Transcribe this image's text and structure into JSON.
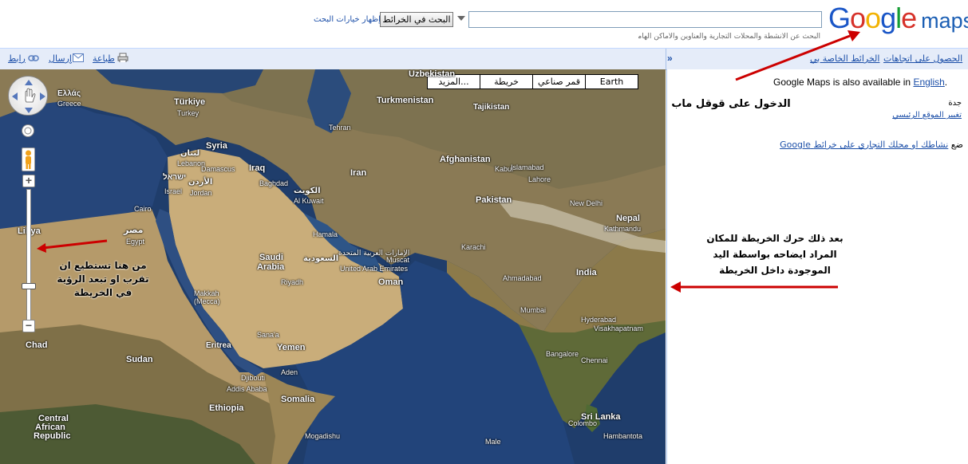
{
  "header": {
    "logo_google": "Google",
    "logo_maps": "maps",
    "search_value": "",
    "search_button": "البحث في الخرائط",
    "show_options": "إظهار خيارات البحث",
    "search_hint": "البحث عن الأنشطة والمحلات التجارية والعناوين والأماكن الهامة."
  },
  "toolbar": {
    "get_directions": "الحصول على اتجاهات",
    "my_maps": "الخرائط الخاصة بي",
    "print": "طباعة",
    "send": "إرسال",
    "link": "رابط",
    "collapse": "»"
  },
  "map_types": [
    "Earth",
    "قمر صناعي",
    "خريطة",
    "المزيد..."
  ],
  "map_labels": [
    {
      "name": "Uzbekistan"
    },
    {
      "name": "Turkmenistan"
    },
    {
      "name": "Tajikistan"
    },
    {
      "name": "Türkiye"
    },
    {
      "name": "Turkey"
    },
    {
      "name": "Ελλάς"
    },
    {
      "name": "Greece"
    },
    {
      "name": "Syria"
    },
    {
      "name": "لبنان"
    },
    {
      "name": "Lebanon"
    },
    {
      "name": "ישראל"
    },
    {
      "name": "Israel"
    },
    {
      "name": "الأردن"
    },
    {
      "name": "Jordan"
    },
    {
      "name": "Iraq"
    },
    {
      "name": "Iran"
    },
    {
      "name": "Afghanistan"
    },
    {
      "name": "Pakistan"
    },
    {
      "name": "Nepal"
    },
    {
      "name": "India"
    },
    {
      "name": "الكويت"
    },
    {
      "name": "Al Kuwait"
    },
    {
      "name": "مصر"
    },
    {
      "name": "Egypt"
    },
    {
      "name": "Libya"
    },
    {
      "name": "Saudi"
    },
    {
      "name": "Arabia"
    },
    {
      "name": "السعودية"
    },
    {
      "name": "الإمارات العربية المتحدة"
    },
    {
      "name": "United Arab Emirates"
    },
    {
      "name": "Oman"
    },
    {
      "name": "Muscat"
    },
    {
      "name": "Karachi"
    },
    {
      "name": "Ahmadabad"
    },
    {
      "name": "Mumbai"
    },
    {
      "name": "Hyderabad"
    },
    {
      "name": "Visakhapatnam"
    },
    {
      "name": "Bangalore"
    },
    {
      "name": "Chennai"
    },
    {
      "name": "Sri Lanka"
    },
    {
      "name": "Yemen"
    },
    {
      "name": "Eritrea"
    },
    {
      "name": "Sudan"
    },
    {
      "name": "Djibouti"
    },
    {
      "name": "Somalia"
    },
    {
      "name": "Ethiopia"
    },
    {
      "name": "Chad"
    },
    {
      "name": "Central"
    },
    {
      "name": "African"
    },
    {
      "name": "Republic"
    },
    {
      "name": "Riyadh"
    },
    {
      "name": "Makkah"
    },
    {
      "name": "(Mecca)"
    },
    {
      "name": "Tehran"
    },
    {
      "name": "Kabul"
    },
    {
      "name": "Islamabad"
    },
    {
      "name": "Lahore"
    },
    {
      "name": "New Delhi"
    },
    {
      "name": "Kathmandu"
    },
    {
      "name": "Baghdad"
    },
    {
      "name": "Damascus"
    },
    {
      "name": "Cairo"
    },
    {
      "name": "Hamala"
    },
    {
      "name": "Sana'a"
    },
    {
      "name": "Aden"
    },
    {
      "name": "Addis Ababa"
    },
    {
      "name": "Mogadishu"
    },
    {
      "name": "Colombo"
    },
    {
      "name": "Male"
    },
    {
      "name": "Hambantota"
    }
  ],
  "annotations": {
    "zoom_note": "من هنا تستطيع ان تقرب او تبعد الرؤية في الخريطة",
    "move_note_l1": "بعد ذلك حرك الخريطة للمكان",
    "move_note_l2": "المراد ايضاحه بواسطة اليد",
    "move_note_l3": "الموجودة داخل الخريطة",
    "login_note": "الدخول على قوقل ماب"
  },
  "sidebar": {
    "available_text": "Google Maps is also available in ",
    "available_link": "English",
    "city": "جدة",
    "change_location": "تغيير الموقع الرئيسي",
    "put_business_prefix": "ضع ",
    "put_business_link": "نشاطك او محلك التجاري على خرائط",
    "put_business_suffix": " Google"
  },
  "colors": {
    "link": "#1c4fa8",
    "toolbar_bg": "#e5ecf9",
    "arrow_red": "#cc0000",
    "sea": "#2a4a78"
  }
}
